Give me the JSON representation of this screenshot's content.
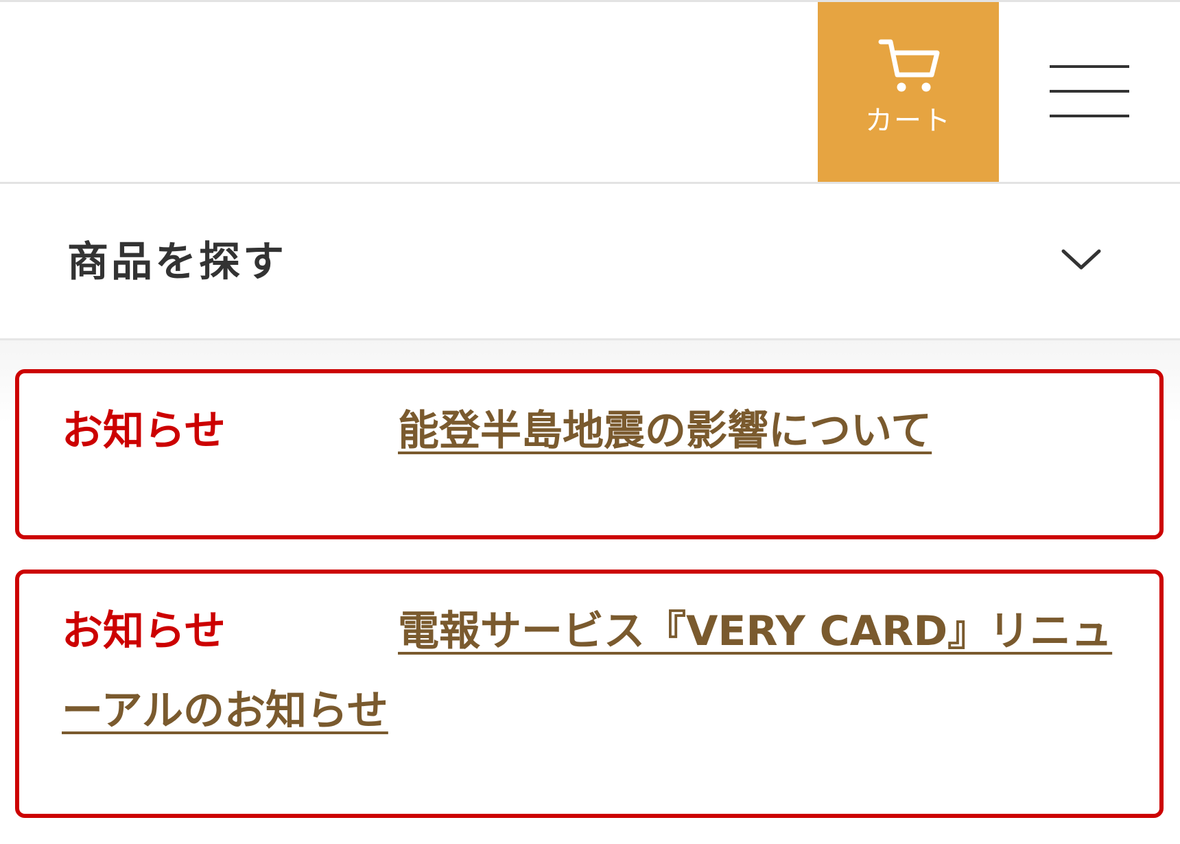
{
  "header": {
    "cart": {
      "label": "カート",
      "icon": "cart-icon",
      "bg_color": "#e6a441"
    },
    "menu": {
      "icon": "hamburger-menu-icon"
    }
  },
  "search": {
    "title": "商品を探す",
    "icon": "chevron-down-icon"
  },
  "notices": [
    {
      "label": "お知らせ",
      "text": "能登半島地震の影響について"
    },
    {
      "label": "お知らせ",
      "text": "電報サービス『VERY CARD』リニューアルのお知らせ"
    }
  ],
  "colors": {
    "notice_border": "#cc0000",
    "notice_label": "#cc0000",
    "notice_link": "#7a5a2e"
  }
}
